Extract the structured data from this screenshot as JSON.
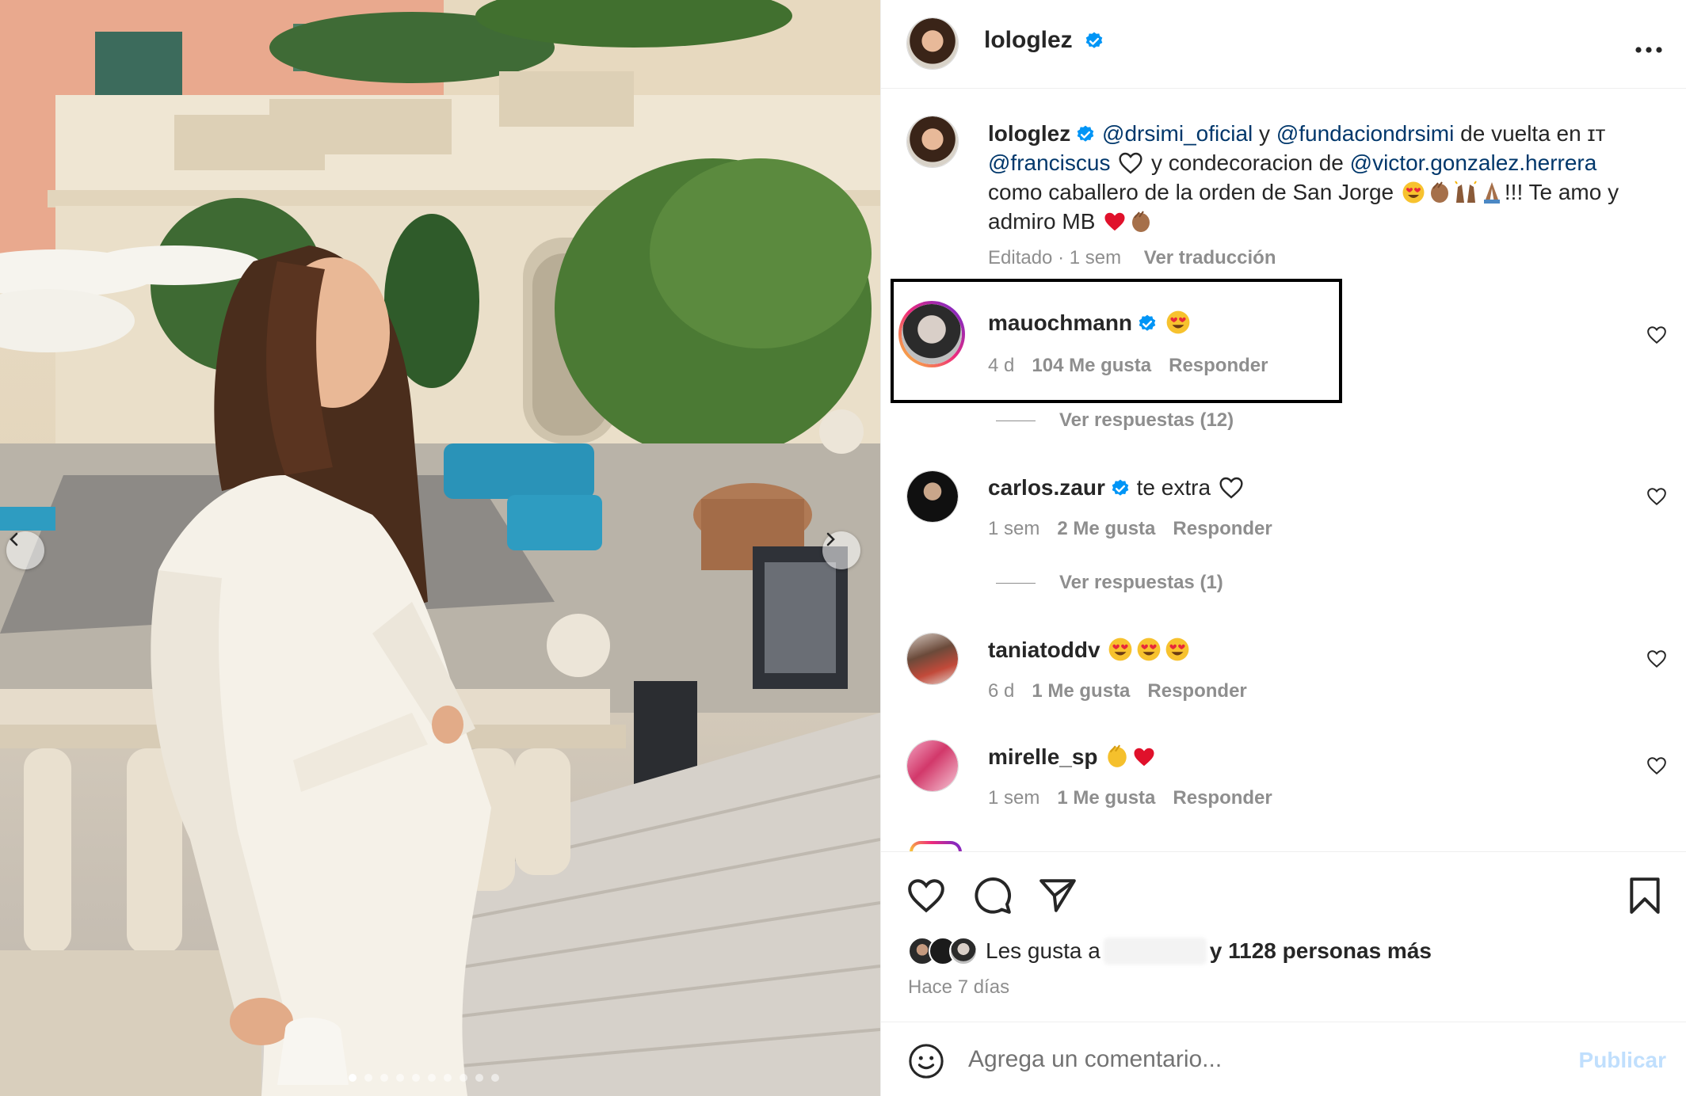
{
  "post": {
    "author": "lologlez",
    "more_icon": "more-horizontal-icon"
  },
  "caption": {
    "author": "lologlez",
    "mention1": "@drsimi_oficial",
    "t1": " y ",
    "mention2": "@fundaciondrsimi",
    "t2": " de vuelta en ɪᴛ",
    "mention3": "@franciscus",
    "t3": " y condecoracion de ",
    "mention4": "@victor.gonzalez.herrera",
    "t4": "como caballero de la orden de San Jorge",
    "t5": "!!! Te amo y",
    "t6": "admiro MB",
    "edited": "Editado · 1 sem",
    "translate": "Ver traducción"
  },
  "comments": [
    {
      "username": "mauochmann",
      "verified": true,
      "text": "",
      "time": "4 d",
      "likes": "104 Me gusta",
      "reply": "Responder",
      "view_replies": "Ver respuestas (12)"
    },
    {
      "username": "carlos.zaur",
      "verified": true,
      "text": "te extra",
      "time": "1 sem",
      "likes": "2 Me gusta",
      "reply": "Responder",
      "view_replies": "Ver respuestas (1)"
    },
    {
      "username": "taniatoddv",
      "verified": false,
      "text": "",
      "time": "6 d",
      "likes": "1 Me gusta",
      "reply": "Responder"
    },
    {
      "username": "mirelle_sp",
      "verified": false,
      "text": "",
      "time": "1 sem",
      "likes": "1 Me gusta",
      "reply": "Responder"
    }
  ],
  "likes": {
    "prefix": "Les gusta a",
    "suffix": "y 1128 personas más",
    "date": "Hace 7 días"
  },
  "composer": {
    "placeholder": "Agrega un comentario...",
    "publish": "Publicar"
  },
  "colors": {
    "verified": "#0095f6",
    "mention": "#00376b",
    "muted": "#8e8e8e",
    "highlight_border": "#000000"
  },
  "carousel": {
    "slides": 10,
    "active_slide": 1
  }
}
